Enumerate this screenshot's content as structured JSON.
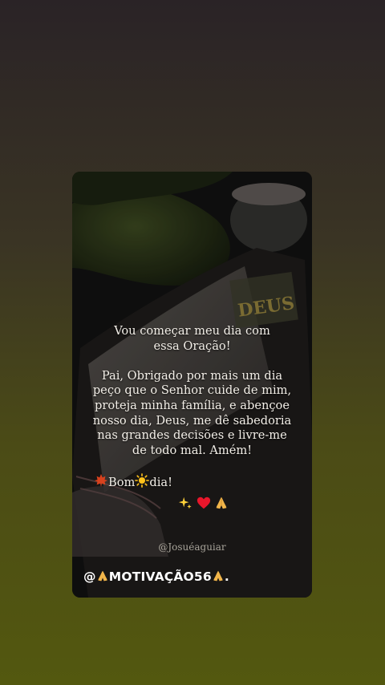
{
  "post": {
    "message": {
      "line1": "Vou começar meu dia com",
      "line2": "essa Oração!",
      "line3": "Pai, Obrigado por mais um dia",
      "line4": "peço que o Senhor cuide de mim,",
      "line5": "proteja minha família, e abençoe",
      "line6": "nosso dia, Deus, me dê sabedoria",
      "line7": "nas grandes decisões e livre-me",
      "line8": "de todo mal. Amém!"
    },
    "greeting": {
      "word1": "Bom",
      "word2": "dia!",
      "icons": [
        "maple-leaf-icon",
        "sun-icon"
      ]
    },
    "emoji_line_icons": [
      "sparkles-icon",
      "red-heart-icon",
      "praying-hands-icon"
    ],
    "credit": "@Josuéaguiar",
    "handle": {
      "prefix": "@",
      "name": "MOTIVAÇÃO56",
      "suffix": "."
    },
    "book_label": "DEUS",
    "colors": {
      "background_top": "#2a2326",
      "background_bottom": "#53580f",
      "text": "#f3efe8"
    }
  }
}
